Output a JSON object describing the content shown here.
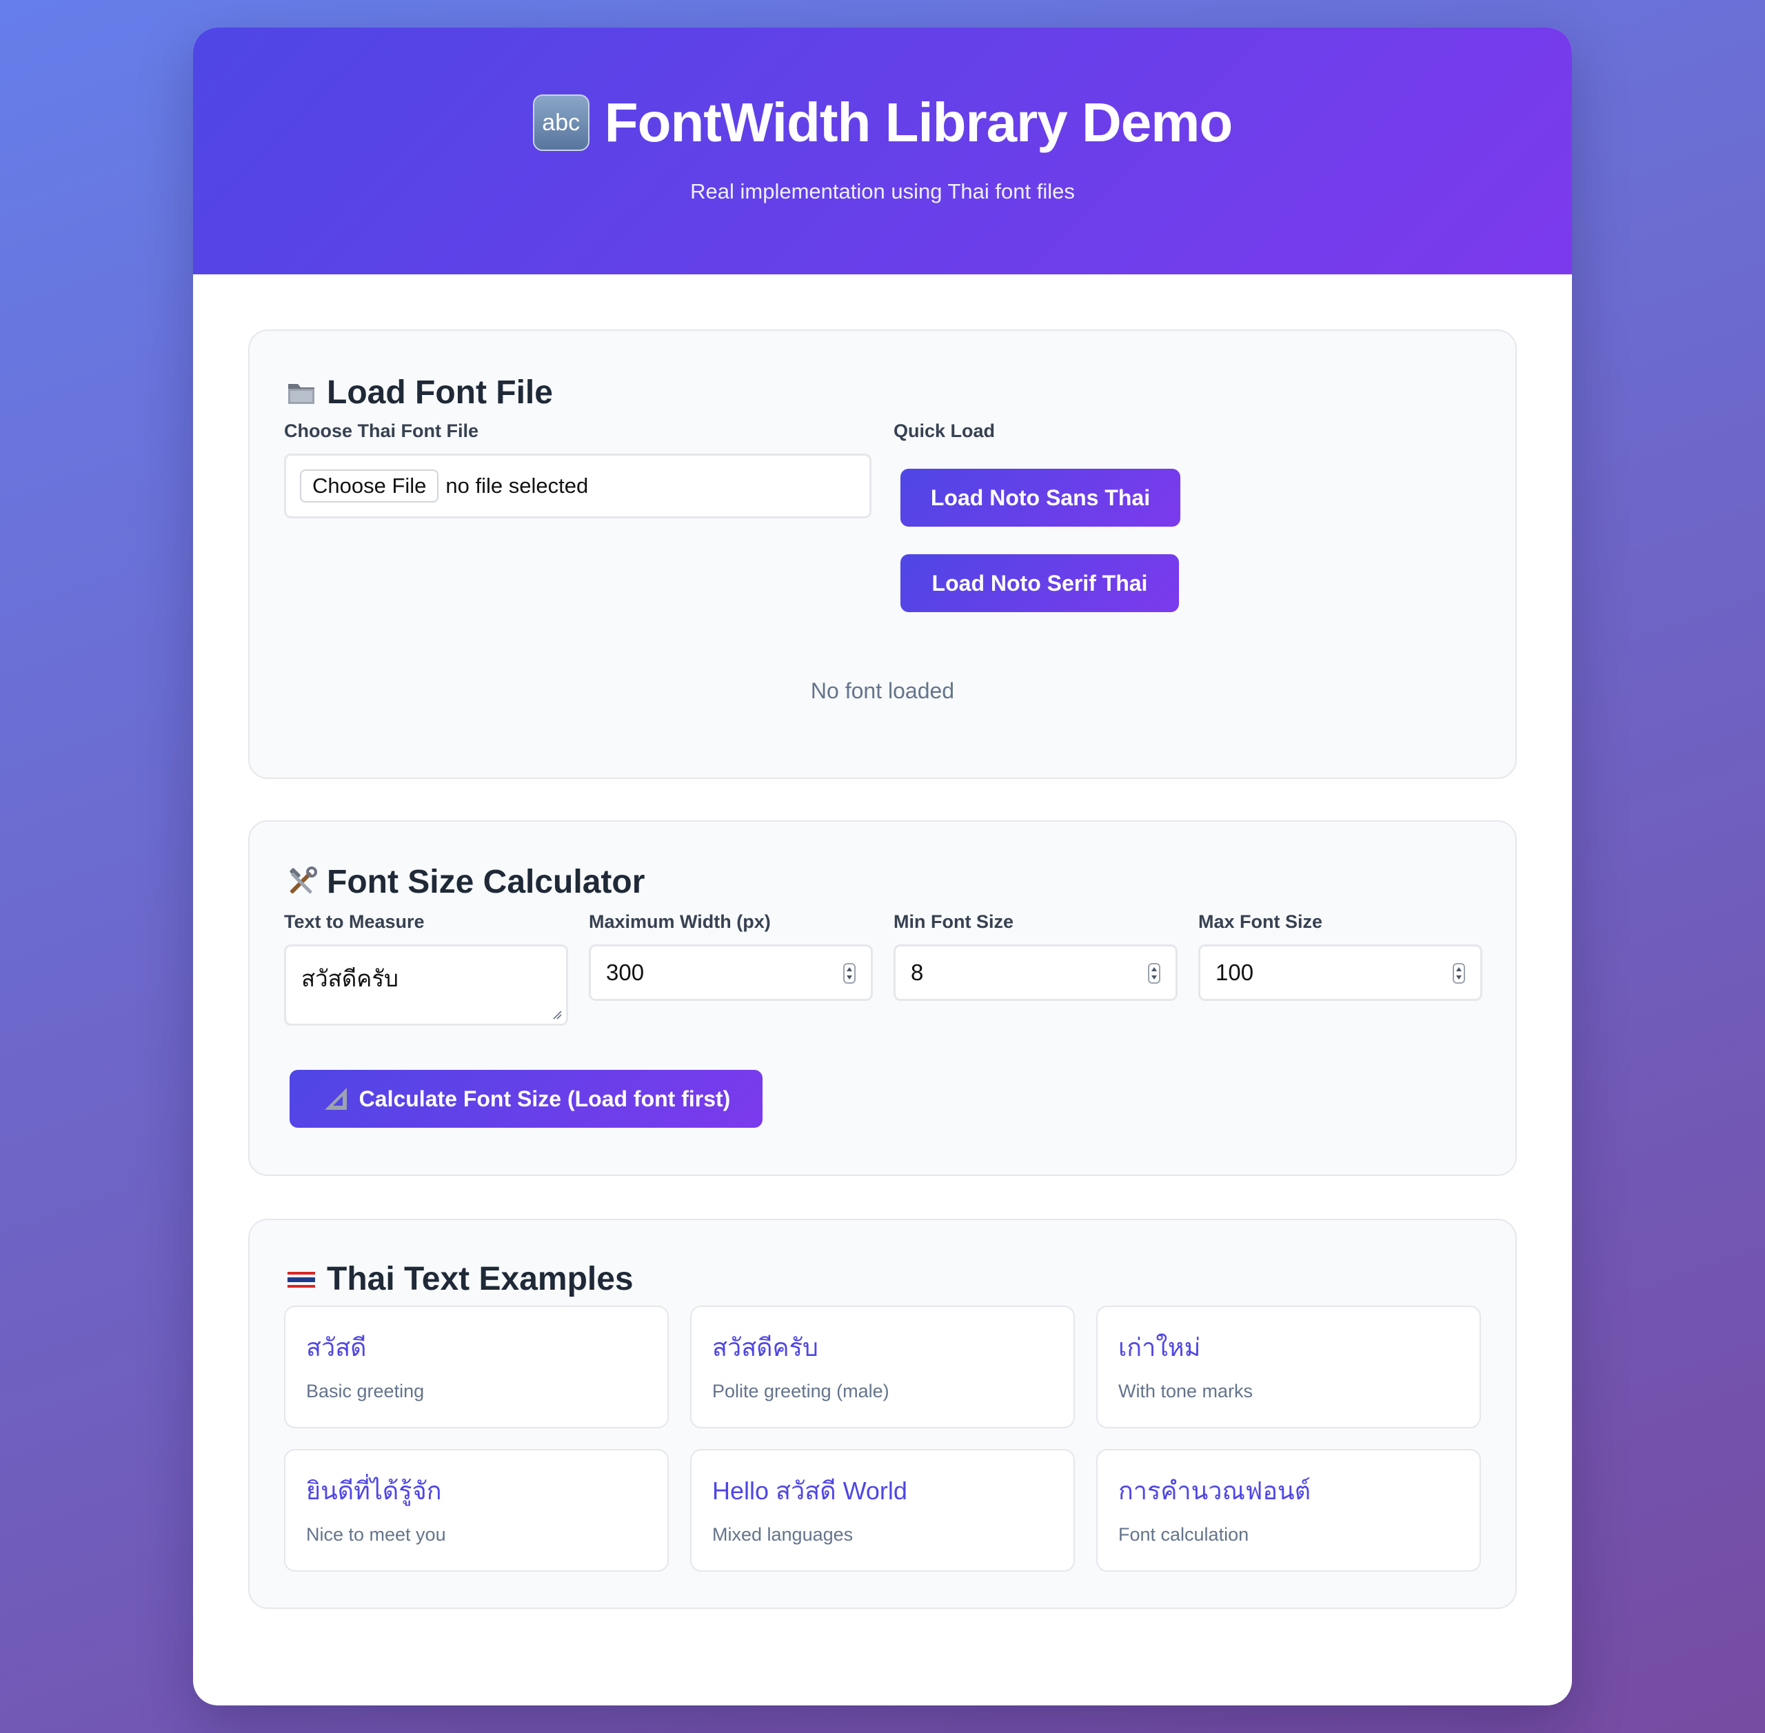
{
  "header": {
    "icon": "abc-icon",
    "icon_text": "abc",
    "title": "FontWidth Library Demo",
    "subtitle": "Real implementation using Thai font files"
  },
  "load_section": {
    "icon": "folder-icon",
    "title": "Load Font File",
    "file_label": "Choose Thai Font File",
    "file_button": "Choose File",
    "file_status": "no file selected",
    "quick_label": "Quick Load",
    "quick_buttons": [
      "Load Noto Sans Thai",
      "Load Noto Serif Thai"
    ],
    "status": "No font loaded"
  },
  "calculator": {
    "icon": "hammer-wrench-icon",
    "title": "Font Size Calculator",
    "fields": [
      {
        "label": "Text to Measure",
        "value": "สวัสดีครับ"
      },
      {
        "label": "Maximum Width (px)",
        "value": "300"
      },
      {
        "label": "Min Font Size",
        "value": "8"
      },
      {
        "label": "Max Font Size",
        "value": "100"
      }
    ],
    "button_icon": "triangular-ruler-icon",
    "button_label": "Calculate Font Size (Load font first)"
  },
  "examples": {
    "icon": "thai-flag-icon",
    "title": "Thai Text Examples",
    "items": [
      {
        "text": "สวัสดี",
        "desc": "Basic greeting"
      },
      {
        "text": "สวัสดีครับ",
        "desc": "Polite greeting (male)"
      },
      {
        "text": "เก่าใหม่",
        "desc": "With tone marks"
      },
      {
        "text": "ยินดีที่ได้รู้จัก",
        "desc": "Nice to meet you"
      },
      {
        "text": "Hello สวัสดี World",
        "desc": "Mixed languages"
      },
      {
        "text": "การคำนวณฟอนต์",
        "desc": "Font calculation"
      }
    ]
  },
  "colors": {
    "accent_start": "#4f46e5",
    "accent_end": "#7c3aed",
    "background_start": "#667eea",
    "background_end": "#764ba2"
  }
}
